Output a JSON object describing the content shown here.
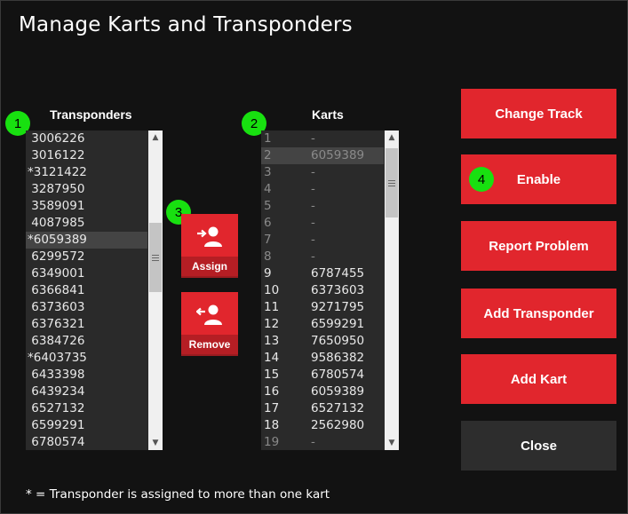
{
  "window": {
    "title": "Manage Karts and Transponders"
  },
  "transponders": {
    "header": "Transponders",
    "badge": "1",
    "items": [
      " 3006226",
      " 3016122",
      "*3121422",
      " 3287950",
      " 3589091",
      " 4087985",
      "*6059389",
      " 6299572",
      " 6349001",
      " 6366841",
      " 6373603",
      " 6376321",
      " 6384726",
      "*6403735",
      " 6433398",
      " 6439234",
      " 6527132",
      " 6599291",
      " 6780574"
    ],
    "selected_index": 6
  },
  "karts": {
    "header": "Karts",
    "badge": "2",
    "rows": [
      {
        "num": "1",
        "transponder": "-"
      },
      {
        "num": "2",
        "transponder": "6059389"
      },
      {
        "num": "3",
        "transponder": "-"
      },
      {
        "num": "4",
        "transponder": "-"
      },
      {
        "num": "5",
        "transponder": "-"
      },
      {
        "num": "6",
        "transponder": "-"
      },
      {
        "num": "7",
        "transponder": "-"
      },
      {
        "num": "8",
        "transponder": "-"
      },
      {
        "num": "9",
        "transponder": "6787455"
      },
      {
        "num": "10",
        "transponder": "6373603"
      },
      {
        "num": "11",
        "transponder": "9271795"
      },
      {
        "num": "12",
        "transponder": "6599291"
      },
      {
        "num": "13",
        "transponder": "7650950"
      },
      {
        "num": "14",
        "transponder": "9586382"
      },
      {
        "num": "15",
        "transponder": "6780574"
      },
      {
        "num": "16",
        "transponder": "6059389"
      },
      {
        "num": "17",
        "transponder": "6527132"
      },
      {
        "num": "18",
        "transponder": "2562980"
      },
      {
        "num": "19",
        "transponder": "-"
      }
    ],
    "selected_index": 1
  },
  "actions": {
    "badge": "3",
    "assign_label": "Assign",
    "remove_label": "Remove"
  },
  "buttons": {
    "change_track": "Change Track",
    "enable": "Enable",
    "enable_badge": "4",
    "report_problem": "Report Problem",
    "add_transponder": "Add Transponder",
    "add_kart": "Add Kart",
    "close": "Close"
  },
  "footnote": "* = Transponder is assigned to more than one kart",
  "colors": {
    "accent": "#e1262d",
    "badge": "#18e010",
    "background": "#121212"
  }
}
